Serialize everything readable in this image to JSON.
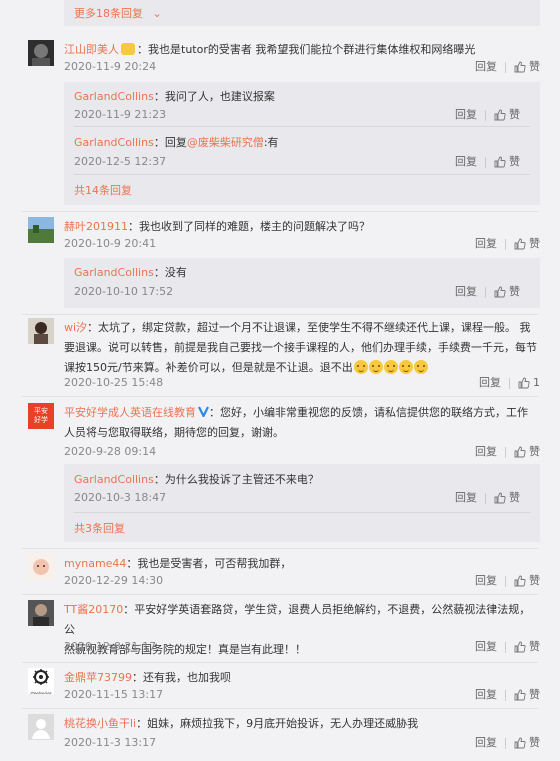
{
  "top_more": {
    "label": "更多18条回复"
  },
  "comments": [
    {
      "user": "江山即美人",
      "text": "：我也是tutor的受害者 我希望我们能拉个群进行集体维权和网络曝光",
      "date": "2020-11-9 20:24",
      "reply_label": "回复",
      "like_label": "赞",
      "replies": [
        {
          "user": "GarlandCollins",
          "text": "：我问了人，也建议报案",
          "date": "2020-11-9 21:23",
          "reply_label": "回复",
          "like_label": "赞"
        },
        {
          "user": "GarlandCollins",
          "prefix": "：回复",
          "mention": "@废柴柴研究僧",
          "text": ":有",
          "date": "2020-12-5 12:37",
          "reply_label": "回复",
          "like_label": "赞"
        }
      ],
      "more_label": "共14条回复"
    },
    {
      "user": "赫叶201911",
      "text": "：我也收到了同样的难题，楼主的问题解决了吗？",
      "date": "2020-10-9 20:41",
      "reply_label": "回复",
      "like_label": "赞",
      "replies": [
        {
          "user": "GarlandCollins",
          "text": "：没有",
          "date": "2020-10-10 17:52",
          "reply_label": "回复",
          "like_label": "赞"
        }
      ]
    },
    {
      "user": "wi汐",
      "text_line1": "：太坑了，绑定贷款，超过一个月不让退课，至使学生不得不继续还代上课，课程一般。 我",
      "text_line2": "要退课。说可以转售，前提是我自己要找一个接手课程的人，他们办理手续，手续费一千元，每节",
      "text_line3": "课按150元/节来算。补差价可以，但是就是不让退。退不出",
      "date": "2020-10-25 15:48",
      "reply_label": "回复",
      "like_count": "1"
    },
    {
      "user": "平安好学成人英语在线教育",
      "text_line1": "：您好，小编非常重视您的反馈，请私信提供您的联络方式，工作",
      "text_line2": "人员将与您取得联络，期待您的回复，谢谢。",
      "date": "2020-9-28 09:14",
      "reply_label": "回复",
      "like_label": "赞",
      "avatar_text": "平安好学",
      "replies": [
        {
          "user": "GarlandCollins",
          "text": "：为什么我投诉了主管还不来电？",
          "date": "2020-10-3 18:47",
          "reply_label": "回复",
          "like_label": "赞"
        }
      ],
      "more_label": "共3条回复"
    },
    {
      "user": "myname44",
      "text": "：我也是受害者，可否帮我加群，",
      "date": "2020-12-29 14:30",
      "reply_label": "回复",
      "like_label": "赞"
    },
    {
      "user": "TT酱20170",
      "text_line1": "：平安好学英语套路贷，学生贷，退费人员拒绝解约，不退费，公然藐视法律法规，公",
      "text_line2": "然藐视教育部与国务院的规定！真是岂有此理！！",
      "date": "2020-12-8 21:17",
      "reply_label": "回复",
      "like_label": "赞"
    },
    {
      "user": "金鼎苹73799",
      "text": "：还有我，也加我呗",
      "date": "2020-11-15 13:17",
      "reply_label": "回复",
      "like_label": "赞",
      "avatar_text": "steelseries"
    },
    {
      "user": "桃花换小鱼干li",
      "text": "：姐妹，麻烦拉我下，9月底开始投诉，无人办理还威胁我",
      "date": "2020-11-3 13:17",
      "reply_label": "回复",
      "like_label": "赞"
    }
  ],
  "colors": {
    "accent": "#eb7350",
    "verified": "#2a86e8"
  }
}
